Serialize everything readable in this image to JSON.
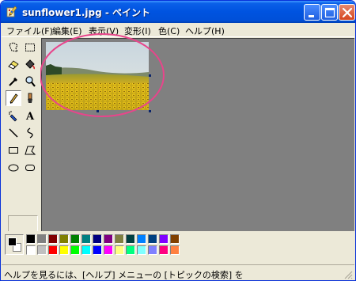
{
  "window": {
    "title": "sunflower1.jpg - ペイント",
    "minimize_icon": "minimize-icon",
    "maximize_icon": "maximize-icon",
    "close_icon": "close-icon",
    "colors": {
      "titlebar": "#0053e0",
      "frame": "#ece9d8",
      "canvas_bg": "#808080",
      "annotation": "#e8458b"
    }
  },
  "menu": [
    {
      "label": "ファイル(F)"
    },
    {
      "label": "編集(E)"
    },
    {
      "label": "表示(V)"
    },
    {
      "label": "変形(I)"
    },
    {
      "label": "色(C)"
    },
    {
      "label": "ヘルプ(H)"
    }
  ],
  "tools": [
    {
      "name": "free-form-select-icon"
    },
    {
      "name": "select-icon"
    },
    {
      "name": "eraser-icon"
    },
    {
      "name": "fill-bucket-icon"
    },
    {
      "name": "eyedropper-icon"
    },
    {
      "name": "magnifier-icon"
    },
    {
      "name": "pencil-icon",
      "selected": true
    },
    {
      "name": "brush-icon"
    },
    {
      "name": "airbrush-icon"
    },
    {
      "name": "text-icon",
      "glyph": "A"
    },
    {
      "name": "line-icon"
    },
    {
      "name": "curve-icon"
    },
    {
      "name": "rectangle-icon"
    },
    {
      "name": "polygon-icon"
    },
    {
      "name": "ellipse-icon"
    },
    {
      "name": "rounded-rectangle-icon"
    }
  ],
  "colors": {
    "foreground": "#000000",
    "background": "#ffffff",
    "palette_top": [
      "#000000",
      "#808080",
      "#800000",
      "#808000",
      "#008000",
      "#008080",
      "#000080",
      "#800080",
      "#808040",
      "#004040",
      "#0080ff",
      "#004080",
      "#8000ff",
      "#804000"
    ],
    "palette_bottom": [
      "#ffffff",
      "#c0c0c0",
      "#ff0000",
      "#ffff00",
      "#00ff00",
      "#00ffff",
      "#0000ff",
      "#ff00ff",
      "#ffff80",
      "#00ff80",
      "#80ffff",
      "#8080ff",
      "#ff0080",
      "#ff8040"
    ]
  },
  "status": {
    "text": "ヘルプを見るには、[ヘルプ] メニューの [トピックの検索] を"
  }
}
